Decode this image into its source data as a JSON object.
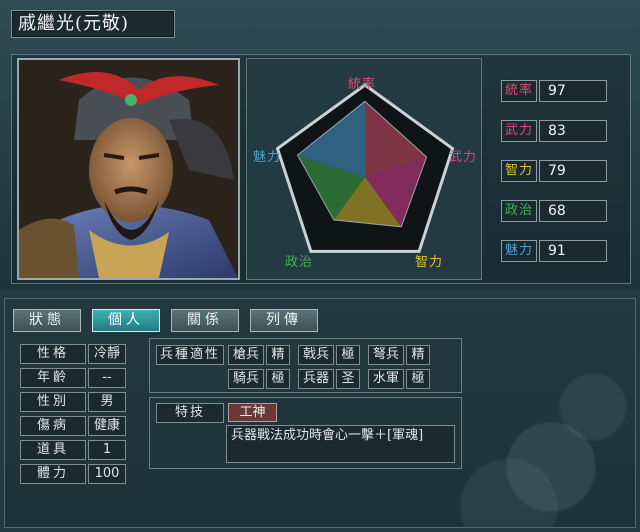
{
  "general": {
    "name": "戚繼光(元敬)"
  },
  "radar": {
    "labels": {
      "command": "統率",
      "strength": "武力",
      "intelligence": "智力",
      "politics": "政治",
      "charisma": "魅力"
    },
    "colors": {
      "command": "#d9506e",
      "strength": "#e04098",
      "intelligence": "#e0c030",
      "politics": "#40b050",
      "charisma": "#4aa0d8"
    }
  },
  "stats": [
    {
      "label": "統率",
      "value": "97",
      "color": "#d9506e"
    },
    {
      "label": "武力",
      "value": "83",
      "color": "#e04098"
    },
    {
      "label": "智力",
      "value": "79",
      "color": "#e0c030"
    },
    {
      "label": "政治",
      "value": "68",
      "color": "#40b050"
    },
    {
      "label": "魅力",
      "value": "91",
      "color": "#4aa0d8"
    }
  ],
  "tabs": [
    {
      "label": "狀態",
      "active": false
    },
    {
      "label": "個人",
      "active": true
    },
    {
      "label": "關係",
      "active": false
    },
    {
      "label": "列傳",
      "active": false
    }
  ],
  "info": [
    {
      "label": "性格",
      "value": "冷靜"
    },
    {
      "label": "年齡",
      "value": "--"
    },
    {
      "label": "性別",
      "value": "男"
    },
    {
      "label": "傷病",
      "value": "健康"
    },
    {
      "label": "道具",
      "value": "1"
    },
    {
      "label": "體力",
      "value": "100"
    }
  ],
  "aptitude": {
    "title": "兵種適性",
    "items": [
      {
        "unit": "槍兵",
        "grade": "精"
      },
      {
        "unit": "戟兵",
        "grade": "極"
      },
      {
        "unit": "弩兵",
        "grade": "精"
      },
      {
        "unit": "騎兵",
        "grade": "極"
      },
      {
        "unit": "兵器",
        "grade": "圣"
      },
      {
        "unit": "水軍",
        "grade": "極"
      }
    ]
  },
  "skill": {
    "title": "特技",
    "name": "工神",
    "description": "兵器戰法成功時會心一擊＋[軍魂]"
  }
}
